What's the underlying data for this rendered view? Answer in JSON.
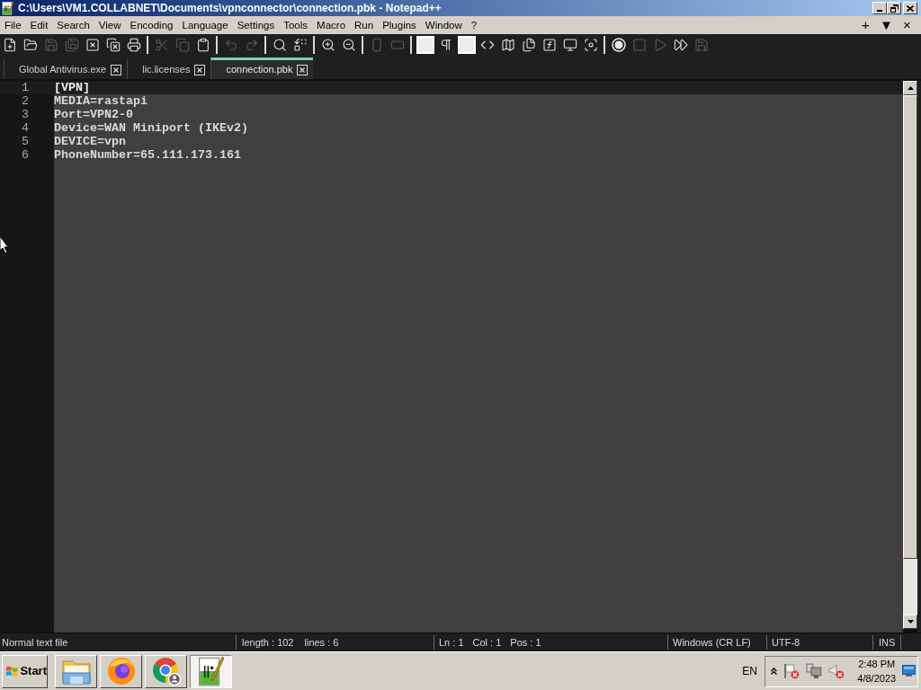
{
  "window": {
    "title": "C:\\Users\\VM1.COLLABNET\\Documents\\vpnconnector\\connection.pbk - Notepad++"
  },
  "menu": [
    "File",
    "Edit",
    "Search",
    "View",
    "Encoding",
    "Language",
    "Settings",
    "Tools",
    "Macro",
    "Run",
    "Plugins",
    "Window",
    "?"
  ],
  "menu_controls": [
    "+",
    "▼",
    "×"
  ],
  "toolbar": [
    [
      {
        "disabled": false
      },
      {
        "disabled": false
      },
      {
        "disabled": true
      },
      {
        "disabled": true
      },
      {
        "disabled": false
      },
      {
        "disabled": false
      },
      {
        "disabled": false
      }
    ],
    [
      {
        "disabled": true
      },
      {
        "disabled": true
      },
      {
        "disabled": false
      }
    ],
    [
      {
        "disabled": true
      },
      {
        "disabled": true
      }
    ],
    [
      {
        "disabled": false
      },
      {
        "disabled": false
      }
    ],
    [
      {
        "disabled": false
      },
      {
        "disabled": false
      }
    ],
    [
      {
        "disabled": true
      },
      {
        "disabled": true
      }
    ],
    [
      {
        "disabled": false
      },
      {
        "disabled": false
      },
      {
        "disabled": false
      },
      {
        "disabled": false
      },
      {
        "disabled": false
      },
      {
        "disabled": false
      },
      {
        "disabled": false
      },
      {
        "disabled": false
      },
      {
        "disabled": false
      }
    ],
    [
      {
        "disabled": false
      },
      {
        "disabled": true
      },
      {
        "disabled": true
      },
      {
        "disabled": false
      },
      {
        "disabled": true
      }
    ]
  ],
  "tabs": [
    {
      "label": "Global Antivirus.exe",
      "selected": false
    },
    {
      "label": "lic.licenses",
      "selected": false
    },
    {
      "label": "connection.pbk",
      "selected": true
    }
  ],
  "editor": {
    "lines": [
      {
        "number": "1",
        "text": "[VPN]",
        "current": true
      },
      {
        "number": "2",
        "text": "MEDIA=rastapi",
        "current": false
      },
      {
        "number": "3",
        "text": "Port=VPN2-0",
        "current": false
      },
      {
        "number": "4",
        "text": "Device=WAN Miniport (IKEv2)",
        "current": false
      },
      {
        "number": "5",
        "text": "DEVICE=vpn",
        "current": false
      },
      {
        "number": "6",
        "text": "PhoneNumber=65.111.173.161",
        "current": false
      }
    ]
  },
  "status_bar": {
    "file_type": "Normal text file",
    "length": "length : 102",
    "lines": "lines : 6",
    "line": "Ln : 1",
    "column": "Col : 1",
    "position": "Pos : 1",
    "eol": "Windows (CR LF)",
    "encoding": "UTF-8",
    "mode": "INS"
  },
  "taskbar": {
    "start": "Start",
    "apps": [
      {
        "selected": false
      },
      {
        "selected": false
      },
      {
        "selected": false
      },
      {
        "selected": true
      }
    ],
    "language": "EN",
    "time": "2:48 PM",
    "date": "4/8/2023"
  }
}
